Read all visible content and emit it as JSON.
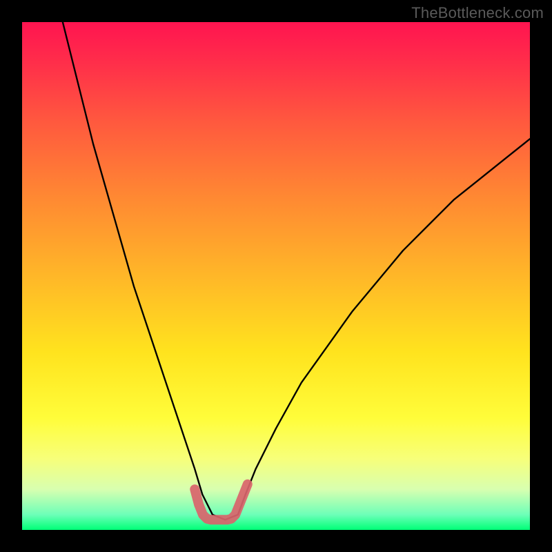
{
  "watermark": "TheBottleneck.com",
  "chart_data": {
    "type": "line",
    "title": "",
    "xlabel": "",
    "ylabel": "",
    "xlim": [
      0,
      100
    ],
    "ylim": [
      0,
      100
    ],
    "grid": false,
    "legend": false,
    "series": [
      {
        "name": "bottleneck-curve",
        "x": [
          8,
          10,
          12,
          14,
          16,
          18,
          20,
          22,
          24,
          26,
          28,
          30,
          32,
          34,
          35.5,
          37.5,
          40,
          42.5,
          44,
          46,
          50,
          55,
          60,
          65,
          70,
          75,
          80,
          85,
          90,
          95,
          100
        ],
        "y": [
          100,
          92,
          84,
          76,
          69,
          62,
          55,
          48,
          42,
          36,
          30,
          24,
          18,
          12,
          7,
          3,
          2,
          3,
          7,
          12,
          20,
          29,
          36,
          43,
          49,
          55,
          60,
          65,
          69,
          73,
          77
        ]
      }
    ],
    "highlight": {
      "name": "optimal-range",
      "x": [
        34.0,
        34.8,
        35.6,
        36.4,
        37.2,
        38.0,
        38.8,
        39.6,
        40.4,
        41.2,
        42.0,
        42.8,
        43.6,
        44.4
      ],
      "y": [
        8.0,
        5.0,
        3.0,
        2.2,
        2.0,
        2.0,
        2.0,
        2.0,
        2.0,
        2.2,
        3.0,
        5.0,
        7.0,
        9.0
      ]
    }
  }
}
